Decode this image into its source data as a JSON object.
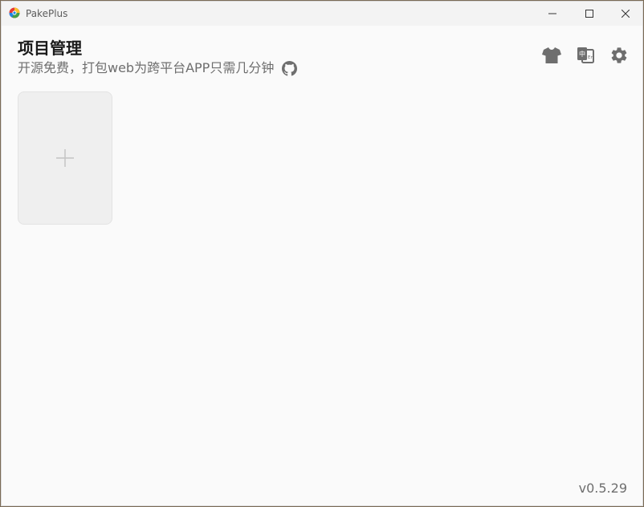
{
  "window": {
    "app_title": "PakePlus",
    "logo_icon": "pakeplus-logo-icon",
    "controls": [
      "minimize-icon",
      "maximize-icon",
      "close-icon"
    ]
  },
  "header": {
    "title": "项目管理",
    "subtitle": "开源免费，打包web为跨平台APP只需几分钟",
    "github_icon": "github-icon"
  },
  "toolbar": {
    "icons": [
      "tshirt-icon",
      "translate-icon",
      "gear-icon"
    ]
  },
  "projects": {
    "add_card_icon": "plus-icon"
  },
  "footer": {
    "version": "v0.5.29"
  },
  "colors": {
    "background": "#fafafa",
    "titlebar": "#f3f3f3",
    "icon": "#6e6e6e",
    "card": "#efefef"
  }
}
